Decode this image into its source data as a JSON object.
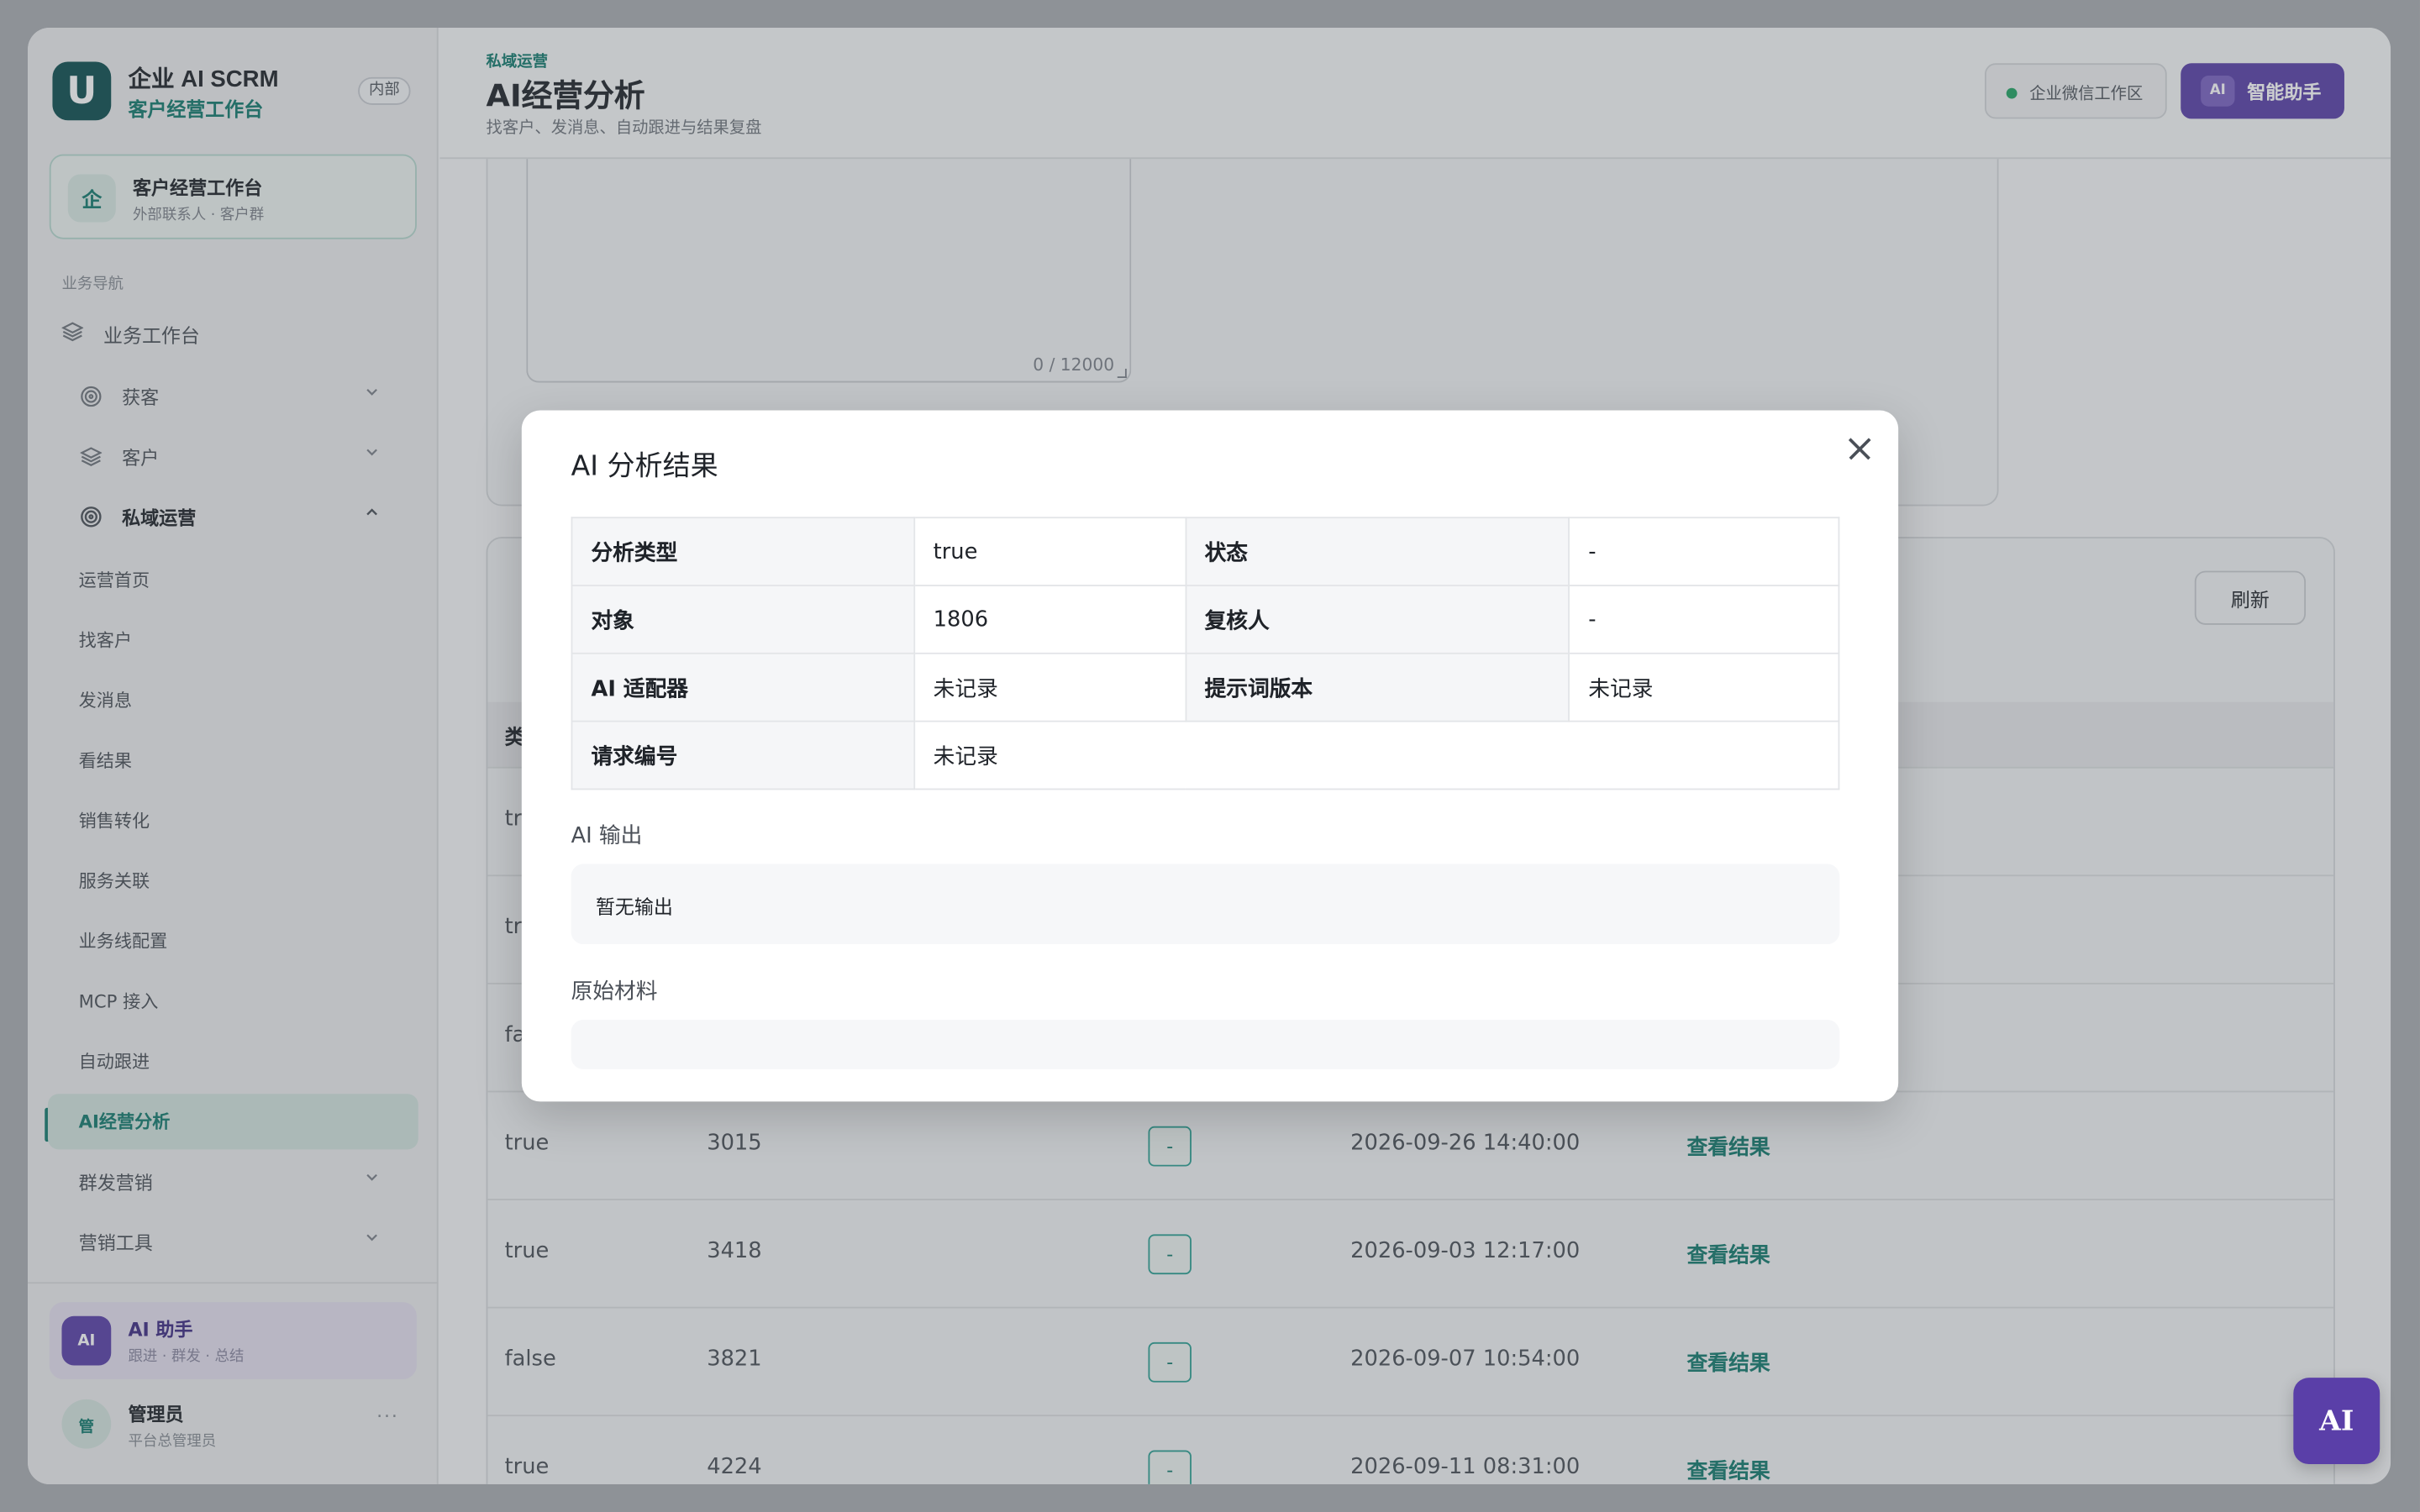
{
  "brand": {
    "logo_letter": "U",
    "name": "企业 AI SCRM",
    "subtitle": "客户经营工作台",
    "badge": "内部"
  },
  "workspace": {
    "icon": "企",
    "title": "客户经营工作台",
    "subtitle": "外部联系人 · 客户群"
  },
  "nav_section": "业务导航",
  "nav": {
    "workbench": "业务工作台",
    "acquire": "获客",
    "customer": "客户",
    "private": "私域运营",
    "sub_items": [
      "运营首页",
      "找客户",
      "发消息",
      "看结果",
      "销售转化",
      "服务关联",
      "业务线配置",
      "MCP 接入",
      "自动跟进",
      "AI经营分析"
    ],
    "group_marketing": "群发营销",
    "marketing_tools": "营销工具"
  },
  "ai_helper": {
    "icon": "AI",
    "title": "AI 助手",
    "subtitle": "跟进 · 群发 · 总结"
  },
  "user": {
    "avatar": "管",
    "name": "管理员",
    "role": "平台总管理员",
    "more": "···"
  },
  "header": {
    "breadcrumb": "私域运营",
    "title": "AI经营分析",
    "subtitle": "找客户、发消息、自动跟进与结果复盘",
    "wechat_label": "企业微信工作区",
    "assistant_icon": "AI",
    "assistant_label": "智能助手"
  },
  "editor": {
    "counter": "0 / 12000"
  },
  "list": {
    "refresh_label": "刷新",
    "header_partial": "类",
    "peek_rows": [
      "tr",
      "tr",
      "fal"
    ],
    "rows": [
      {
        "type": "true",
        "id": "3015",
        "status": "-",
        "time": "2026-09-26 14:40:00",
        "action": "查看结果"
      },
      {
        "type": "true",
        "id": "3418",
        "status": "-",
        "time": "2026-09-03 12:17:00",
        "action": "查看结果"
      },
      {
        "type": "false",
        "id": "3821",
        "status": "-",
        "time": "2026-09-07 10:54:00",
        "action": "查看结果"
      },
      {
        "type": "true",
        "id": "4224",
        "status": "-",
        "time": "2026-09-11 08:31:00",
        "action": "查看结果"
      }
    ]
  },
  "modal": {
    "title": "AI 分析结果",
    "fields": {
      "type_k": "分析类型",
      "type_v": "true",
      "status_k": "状态",
      "status_v": "-",
      "target_k": "对象",
      "target_v": "1806",
      "reviewer_k": "复核人",
      "reviewer_v": "-",
      "adapter_k": "AI 适配器",
      "adapter_v": "未记录",
      "prompt_k": "提示词版本",
      "prompt_v": "未记录",
      "req_k": "请求编号",
      "req_v": "未记录"
    },
    "output_label": "AI 输出",
    "output_text": "暂无输出",
    "raw_label": "原始材料",
    "raw_text": ""
  },
  "fab_label": "AI"
}
